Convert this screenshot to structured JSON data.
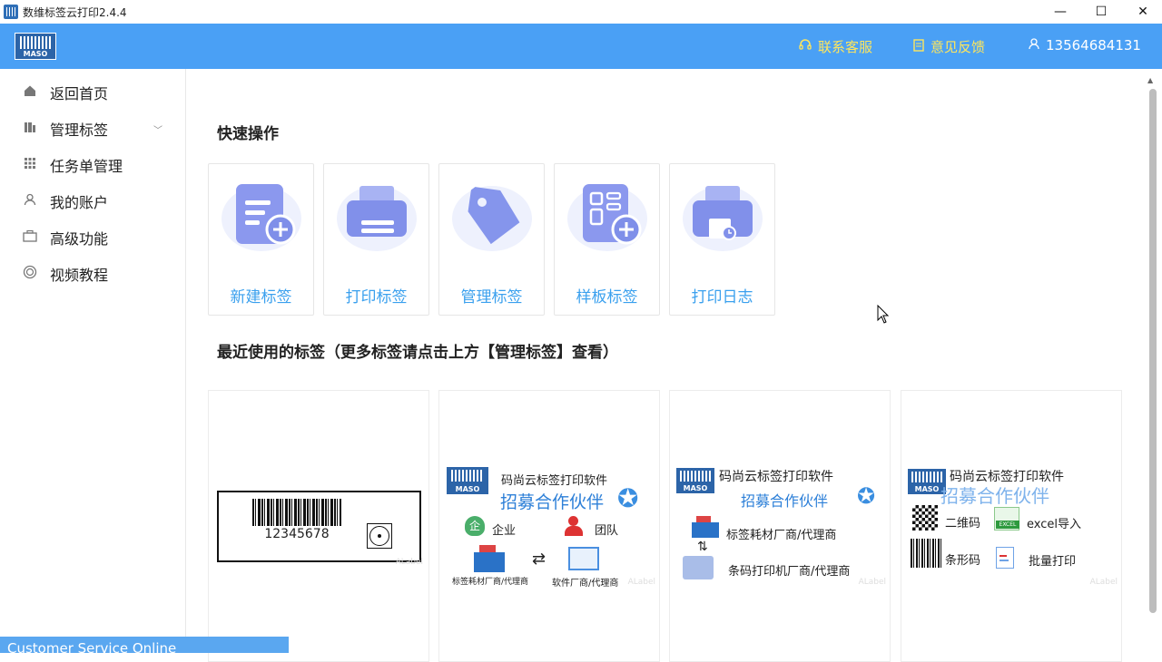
{
  "window": {
    "title": "数维标签云打印2.4.4",
    "minimize": "—",
    "maximize": "☐",
    "close": "✕"
  },
  "header": {
    "logo_text": "MASO",
    "support": "联系客服",
    "feedback": "意见反馈",
    "account": "13564684131"
  },
  "sidebar": {
    "items": [
      {
        "label": "返回首页",
        "icon": "home-icon"
      },
      {
        "label": "管理标签",
        "icon": "label-icon"
      },
      {
        "label": "任务单管理",
        "icon": "grid-icon"
      },
      {
        "label": "我的账户",
        "icon": "user-icon"
      },
      {
        "label": "高级功能",
        "icon": "briefcase-icon"
      },
      {
        "label": "视频教程",
        "icon": "video-icon"
      }
    ]
  },
  "quick": {
    "title": "快速操作",
    "cards": [
      {
        "label": "新建标签"
      },
      {
        "label": "打印标签"
      },
      {
        "label": "管理标签"
      },
      {
        "label": "样板标签"
      },
      {
        "label": "打印日志"
      }
    ]
  },
  "recent": {
    "title": "最近使用的标签（更多标签请点击上方【管理标签】查看）",
    "watermark": "ALabel",
    "card1": {
      "barcode": "12345678"
    },
    "card2": {
      "logo": "MASO",
      "title": "码尚云标签打印软件",
      "subtitle": "招募合作伙伴",
      "enterprise": "企业",
      "enterprise_icon": "企",
      "team": "团队",
      "left": "标签耗材厂商/代理商",
      "right": "软件厂商/代理商"
    },
    "card3": {
      "logo": "MASO",
      "title": "码尚云标签打印软件",
      "subtitle": "招募合作伙伴",
      "line1": "标签耗材厂商/代理商",
      "line2": "条码打印机厂商/代理商"
    },
    "card4": {
      "logo": "MASO",
      "title": "码尚云标签打印软件",
      "subtitle": "招募合作伙伴",
      "qr": "二维码",
      "excel": "excel导入",
      "excel_badge": "EXCEL",
      "barcode": "条形码",
      "batch": "批量打印"
    }
  },
  "footer": {
    "customer_service": "Customer Service Online"
  },
  "colors": {
    "header": "#4aa0f5",
    "accent": "#3aa0ee",
    "highlight": "#ffe65c"
  }
}
